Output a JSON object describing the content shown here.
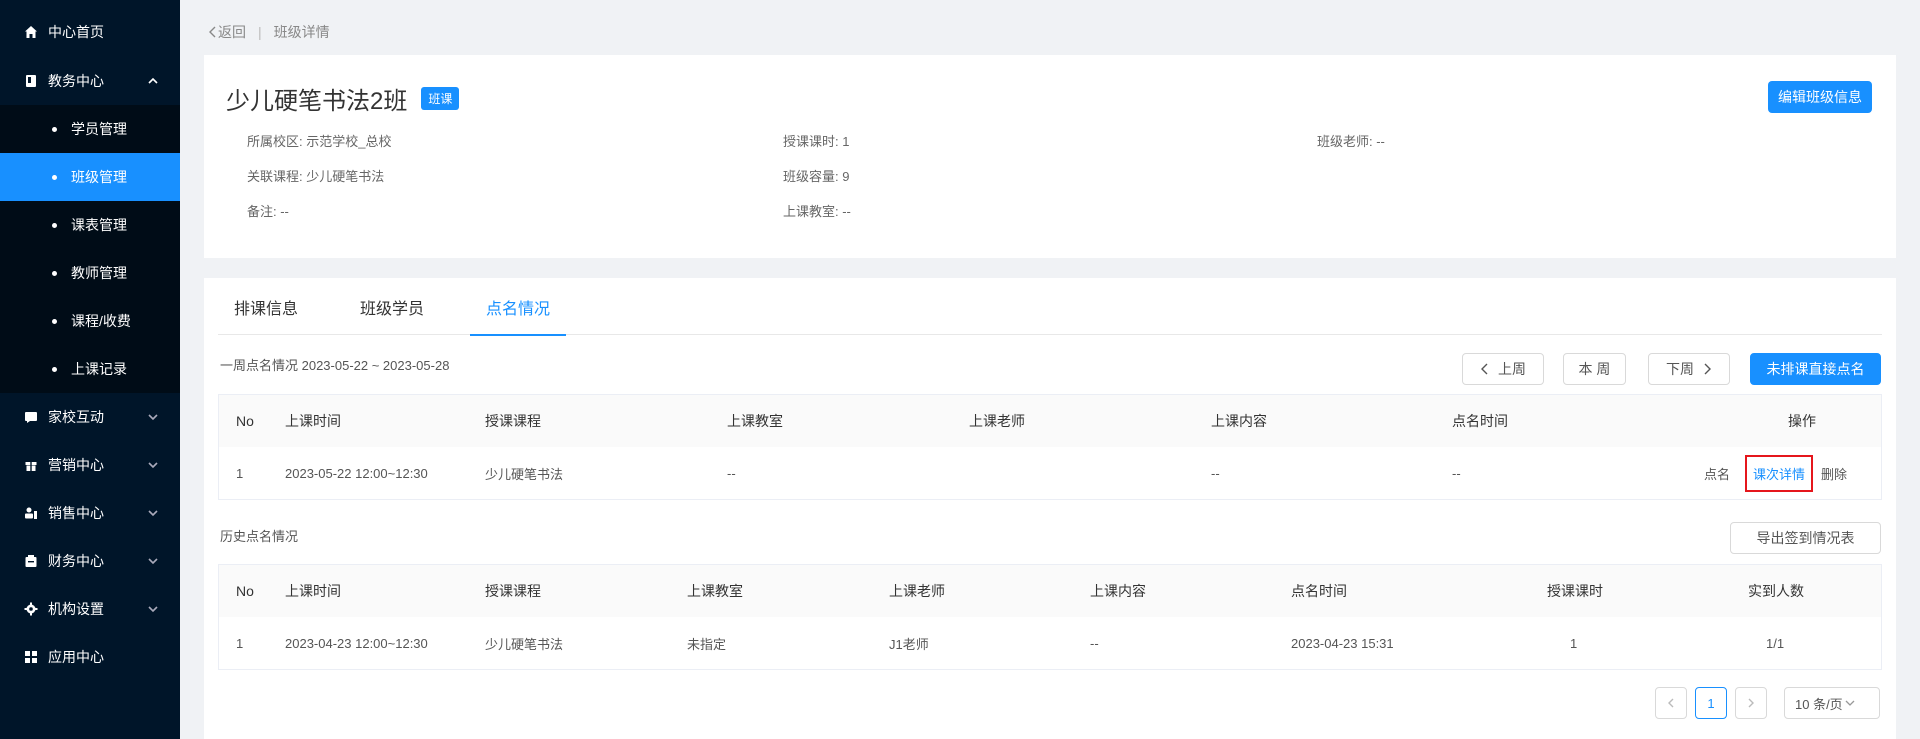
{
  "sidebar": {
    "items": [
      {
        "label": "中心首页",
        "icon": "home-icon"
      },
      {
        "label": "教务中心",
        "icon": "book-icon",
        "expanded": true,
        "children": [
          {
            "label": "学员管理"
          },
          {
            "label": "班级管理",
            "active": true
          },
          {
            "label": "课表管理"
          },
          {
            "label": "教师管理"
          },
          {
            "label": "课程/收费"
          },
          {
            "label": "上课记录"
          }
        ]
      },
      {
        "label": "家校互动",
        "icon": "chat-icon"
      },
      {
        "label": "营销中心",
        "icon": "gift-icon"
      },
      {
        "label": "销售中心",
        "icon": "sales-icon"
      },
      {
        "label": "财务中心",
        "icon": "finance-icon"
      },
      {
        "label": "机构设置",
        "icon": "gear-icon"
      },
      {
        "label": "应用中心",
        "icon": "grid-icon"
      }
    ]
  },
  "breadcrumb": {
    "back": "返回",
    "separator": "|",
    "current": "班级详情"
  },
  "class_info": {
    "title": "少儿硬笔书法2班",
    "tag": "班课",
    "edit_button": "编辑班级信息",
    "campus": "所属校区: 示范学校_总校",
    "hours": "授课课时: 1",
    "teacher": "班级老师: --",
    "course": "关联课程: 少儿硬笔书法",
    "capacity": "班级容量: 9",
    "remark": "备注: --",
    "classroom": "上课教室: --"
  },
  "tabs": [
    {
      "label": "排课信息"
    },
    {
      "label": "班级学员"
    },
    {
      "label": "点名情况",
      "active": true
    }
  ],
  "weekly": {
    "label": "一周点名情况 2023-05-22 ~ 2023-05-28",
    "prev": "上周",
    "current": "本 周",
    "next": "下周",
    "direct_rollcall": "未排课直接点名",
    "headers": [
      "No",
      "上课时间",
      "授课课程",
      "上课教室",
      "上课老师",
      "上课内容",
      "点名时间",
      "操作"
    ],
    "rows": [
      {
        "no": "1",
        "time": "2023-05-22 12:00~12:30",
        "course": "少儿硬笔书法",
        "classroom": "--",
        "teacher": "",
        "content": "--",
        "rollcall_time": "--",
        "actions": {
          "rollcall": "点名",
          "detail": "课次详情",
          "delete": "删除"
        }
      }
    ]
  },
  "history": {
    "label": "历史点名情况",
    "export": "导出签到情况表",
    "headers": [
      "No",
      "上课时间",
      "授课课程",
      "上课教室",
      "上课老师",
      "上课内容",
      "点名时间",
      "授课课时",
      "实到人数"
    ],
    "rows": [
      {
        "no": "1",
        "time": "2023-04-23 12:00~12:30",
        "course": "少儿硬笔书法",
        "classroom": "未指定",
        "teacher": "J1老师",
        "content": "--",
        "rollcall_time": "2023-04-23 15:31",
        "hours": "1",
        "attendance": "1/1"
      }
    ]
  },
  "pagination": {
    "page": "1",
    "page_size": "10 条/页"
  },
  "colors": {
    "primary": "#1890ff",
    "sidebar_bg": "#001529",
    "highlight": "#e5161c"
  }
}
